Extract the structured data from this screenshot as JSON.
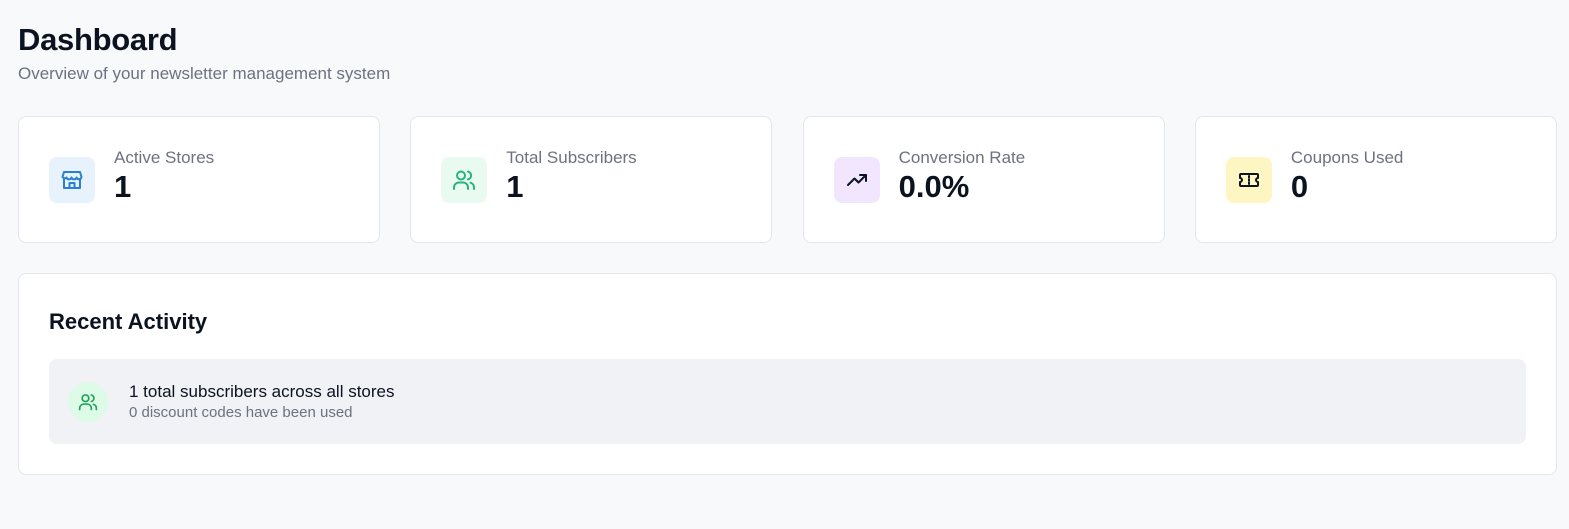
{
  "header": {
    "title": "Dashboard",
    "subtitle": "Overview of your newsletter management system"
  },
  "stats": [
    {
      "label": "Active Stores",
      "value": "1",
      "icon": "store-icon",
      "icon_bg": "#e8f2fd",
      "icon_color": "#2a7fcf"
    },
    {
      "label": "Total Subscribers",
      "value": "1",
      "icon": "users-icon",
      "icon_bg": "#e9faf1",
      "icon_color": "#27b47a"
    },
    {
      "label": "Conversion Rate",
      "value": "0.0%",
      "icon": "trending-up-icon",
      "icon_bg": "#f1e6fd",
      "icon_color": "#0b1220"
    },
    {
      "label": "Coupons Used",
      "value": "0",
      "icon": "ticket-icon",
      "icon_bg": "#fdf6c3",
      "icon_color": "#0b1220"
    }
  ],
  "activity": {
    "title": "Recent Activity",
    "items": [
      {
        "main": "1 total subscribers across all stores",
        "sub": "0 discount codes have been used",
        "icon": "users-icon",
        "icon_bg": "#dcfce7",
        "icon_color": "#22a35a"
      }
    ]
  }
}
